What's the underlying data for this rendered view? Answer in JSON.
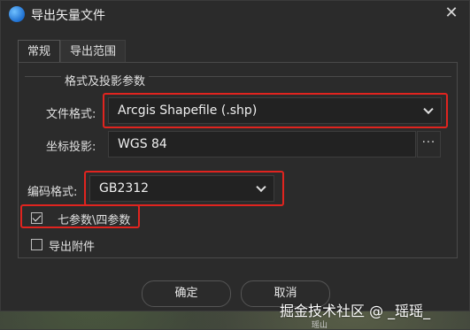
{
  "window": {
    "title": "导出矢量文件",
    "app_icon": "app-logo-icon",
    "close_icon": "close-icon"
  },
  "tabs": [
    {
      "label": "常规",
      "active": true
    },
    {
      "label": "导出范围",
      "active": false
    }
  ],
  "group": {
    "title": "格式及投影参数"
  },
  "file_format": {
    "label": "文件格式:",
    "value": "Arcgis Shapefile (.shp)"
  },
  "coordinate": {
    "label": "坐标投影:",
    "value": "WGS 84",
    "button_label": "···"
  },
  "encoding": {
    "label": "编码格式:",
    "value": "GB2312"
  },
  "options": {
    "seven_params": {
      "label": "七参数\\四参数",
      "checked": true
    },
    "export_attachments": {
      "label": "导出附件",
      "checked": false
    }
  },
  "buttons": {
    "ok": "确定",
    "cancel": "取消"
  },
  "watermark": "掘金技术社区 @ _瑶瑶_",
  "map_label": "瑶山",
  "colors": {
    "highlight": "#e0241f",
    "dialog_bg": "#2b2b2b",
    "input_bg": "#222222"
  }
}
